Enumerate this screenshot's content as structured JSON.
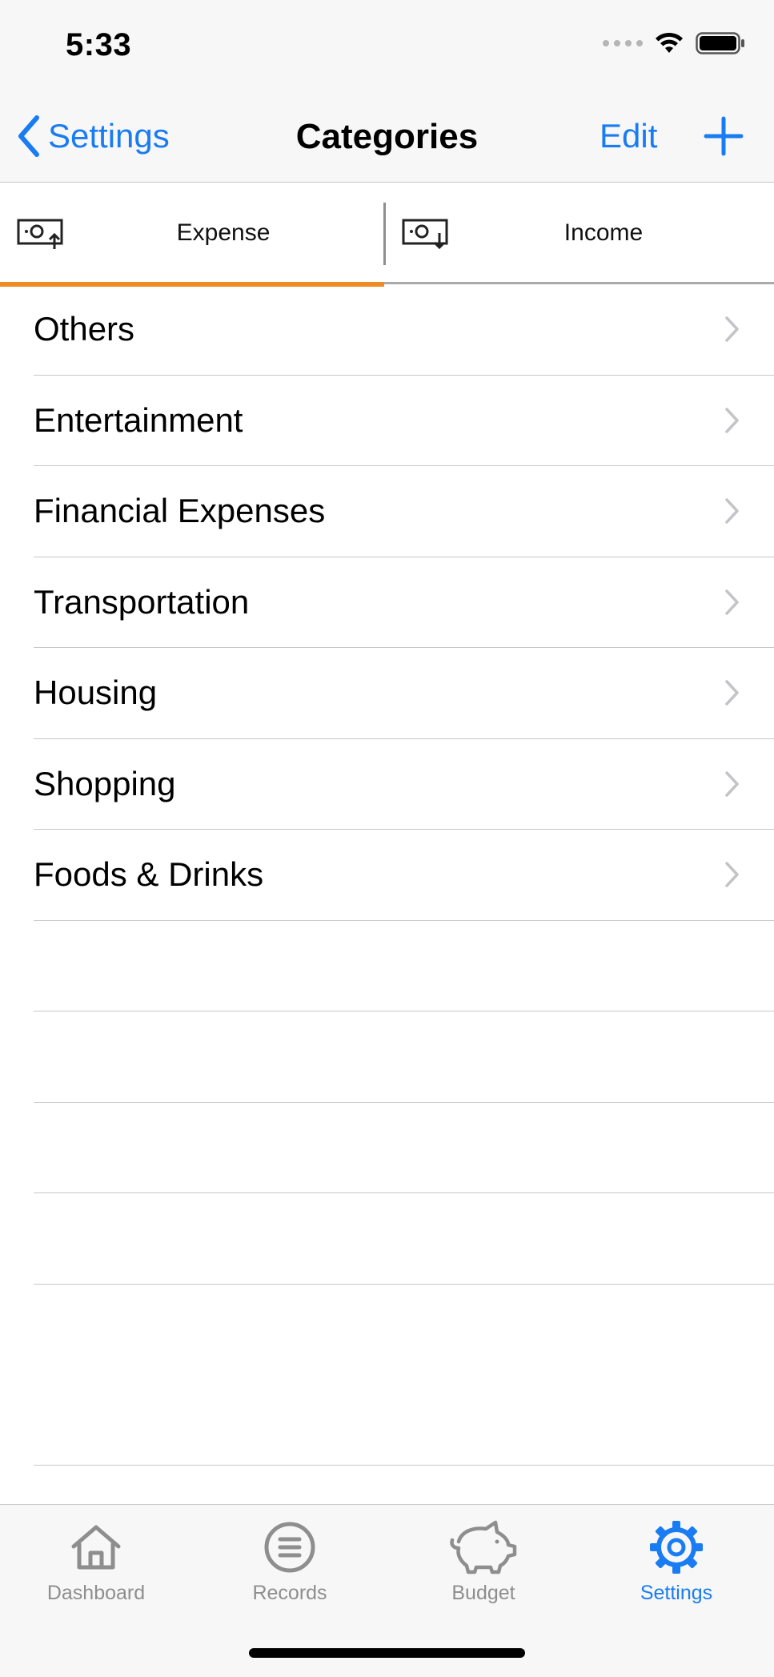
{
  "status_bar": {
    "time": "5:33"
  },
  "nav": {
    "back_label": "Settings",
    "title": "Categories",
    "edit_label": "Edit"
  },
  "segments": [
    {
      "label": "Expense",
      "icon": "cash-out-icon",
      "selected": true
    },
    {
      "label": "Income",
      "icon": "cash-in-icon",
      "selected": false
    }
  ],
  "categories": [
    {
      "label": "Others"
    },
    {
      "label": "Entertainment"
    },
    {
      "label": "Financial Expenses"
    },
    {
      "label": "Transportation"
    },
    {
      "label": "Housing"
    },
    {
      "label": "Shopping"
    },
    {
      "label": "Foods & Drinks"
    }
  ],
  "tab_bar": {
    "items": [
      {
        "label": "Dashboard",
        "icon": "house-icon",
        "active": false
      },
      {
        "label": "Records",
        "icon": "list-circle-icon",
        "active": false
      },
      {
        "label": "Budget",
        "icon": "piggy-bank-icon",
        "active": false
      },
      {
        "label": "Settings",
        "icon": "gear-icon",
        "active": true
      }
    ]
  },
  "colors": {
    "accent": "#1a7cf2",
    "tab_indicator": "#f08a24",
    "inactive": "#8e8e8e",
    "bar_background": "#f7f7f7"
  }
}
